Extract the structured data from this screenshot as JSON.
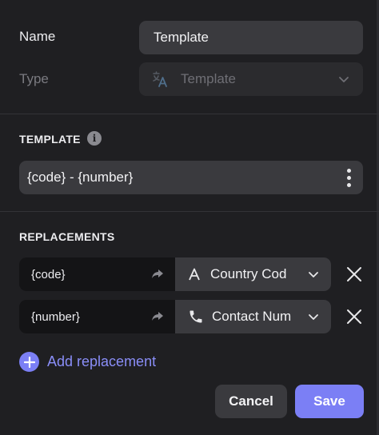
{
  "form": {
    "name_label": "Name",
    "name_value": "Template",
    "type_label": "Type",
    "type_value": "Template",
    "type_icon": "translate-icon"
  },
  "template_section": {
    "title": "TEMPLATE",
    "info_icon": "info-icon",
    "value": "{code} - {number}",
    "menu_icon": "kebab-menu-icon"
  },
  "replacements_section": {
    "title": "REPLACEMENTS",
    "items": [
      {
        "key": "{code}",
        "arrow_icon": "share-arrow-icon",
        "value_icon": "text-a-icon",
        "value": "Country Cod",
        "chevron_icon": "chevron-down-icon",
        "remove_icon": "close-icon"
      },
      {
        "key": "{number}",
        "arrow_icon": "share-arrow-icon",
        "value_icon": "phone-icon",
        "value": "Contact Num",
        "chevron_icon": "chevron-down-icon",
        "remove_icon": "close-icon"
      }
    ],
    "add_label": "Add replacement",
    "add_icon": "plus-circle-icon"
  },
  "actions": {
    "cancel_label": "Cancel",
    "save_label": "Save"
  },
  "colors": {
    "background": "#1f1f22",
    "field": "#3a3a3e",
    "accent": "#7b7ff5"
  }
}
